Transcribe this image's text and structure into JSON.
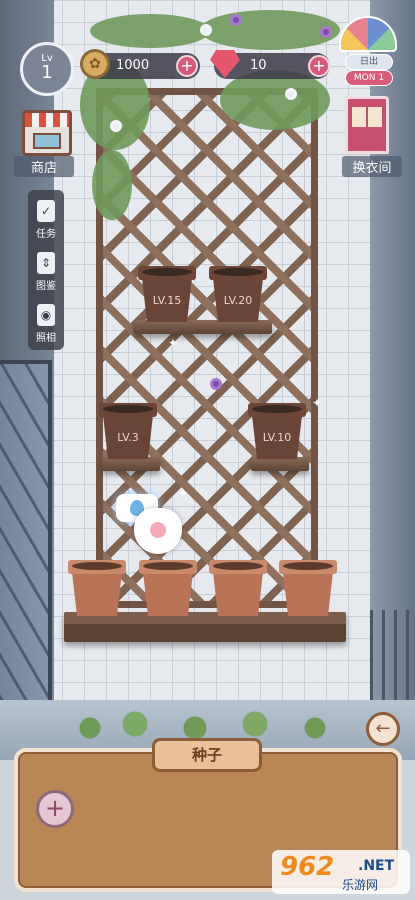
{
  "hud": {
    "level_prefix": "Lv",
    "level": "1",
    "coins": "1000",
    "gems": "10",
    "coin_plus": "+",
    "gem_plus": "+",
    "time_sunrise": "日出",
    "time_day": "MON 1"
  },
  "left_nav": {
    "shop": "商店",
    "task": "任务",
    "album": "图鉴",
    "photo": "照相"
  },
  "right_nav": {
    "wardrobe": "换衣间"
  },
  "pots": [
    {
      "label": "LV.15"
    },
    {
      "label": "LV.20"
    },
    {
      "label": "LV.3"
    },
    {
      "label": "LV.10"
    }
  ],
  "panel": {
    "title": "种子",
    "add": "+",
    "back": "←"
  },
  "watermark": {
    "num": "962",
    "dot": ".NET",
    "cn": "乐游网"
  },
  "colors": {
    "panel": "#b98656",
    "accent_pink": "#d35a7a",
    "coin": "#d7ac5e",
    "gem": "#e4566c"
  }
}
